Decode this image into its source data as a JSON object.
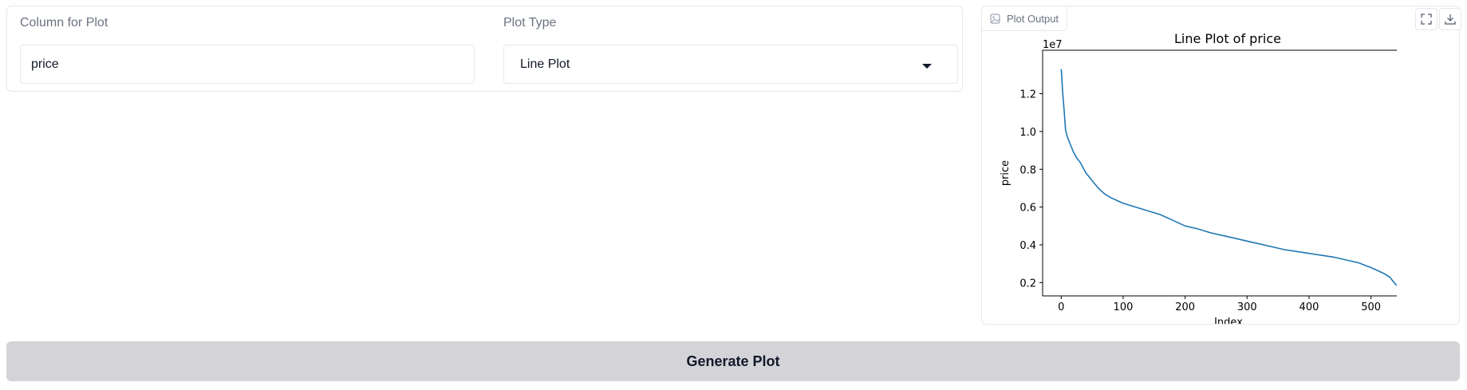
{
  "form": {
    "column_label": "Column for Plot",
    "column_value": "price",
    "plot_type_label": "Plot Type",
    "plot_type_value": "Line Plot"
  },
  "plot_panel": {
    "label": "Plot Output",
    "icons": [
      "image-icon",
      "fullscreen-icon",
      "download-icon"
    ]
  },
  "generate_button": {
    "label": "Generate Plot"
  },
  "chart_data": {
    "type": "line",
    "title": "Line Plot of price",
    "xlabel": "Index",
    "ylabel": "price",
    "y_offset_label": "1e7",
    "xlim": [
      -30,
      570
    ],
    "ylim": [
      0.13,
      1.43
    ],
    "x_ticks": [
      0,
      100,
      200,
      300,
      400,
      500
    ],
    "x_tick_labels": [
      "0",
      "100",
      "200",
      "300",
      "400",
      "500"
    ],
    "y_ticks": [
      0.2,
      0.4,
      0.6,
      0.8,
      1.0,
      1.2
    ],
    "y_tick_labels": [
      "0.2",
      "0.4",
      "0.6",
      "0.8",
      "1.0",
      "1.2"
    ],
    "line_color": "#1f77b4",
    "series": [
      {
        "x": [
          0,
          1,
          2,
          5,
          7,
          10,
          15,
          20,
          25,
          30,
          35,
          40,
          45,
          50,
          55,
          60,
          70,
          80,
          90,
          100,
          120,
          140,
          160,
          180,
          200,
          220,
          240,
          260,
          280,
          300,
          320,
          340,
          360,
          380,
          400,
          420,
          440,
          460,
          480,
          500,
          510,
          520,
          530,
          535,
          540,
          545
        ],
        "y": [
          1.33,
          1.29,
          1.22,
          1.1,
          1.01,
          0.97,
          0.93,
          0.89,
          0.86,
          0.84,
          0.81,
          0.78,
          0.76,
          0.74,
          0.72,
          0.7,
          0.67,
          0.65,
          0.635,
          0.62,
          0.6,
          0.58,
          0.56,
          0.53,
          0.5,
          0.485,
          0.465,
          0.45,
          0.435,
          0.42,
          0.405,
          0.39,
          0.375,
          0.365,
          0.355,
          0.345,
          0.335,
          0.32,
          0.305,
          0.28,
          0.265,
          0.25,
          0.23,
          0.21,
          0.19,
          0.18
        ]
      }
    ]
  }
}
